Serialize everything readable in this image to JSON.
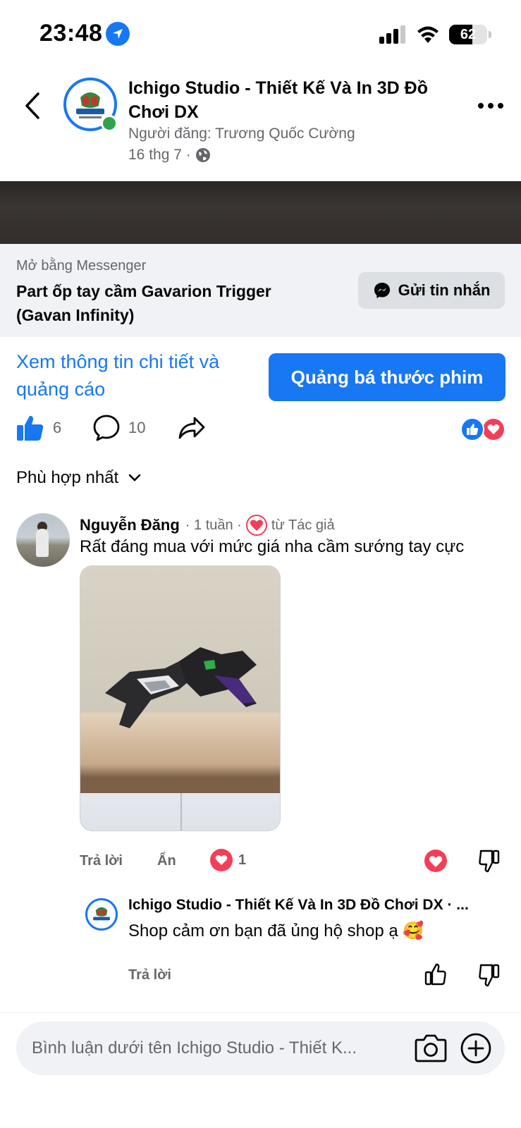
{
  "status_bar": {
    "time": "23:48",
    "battery": "62",
    "battery_level": 0.62
  },
  "post": {
    "page_name": "Ichigo Studio - Thiết Kế Và In 3D Đồ Chơi DX",
    "poster": "Người đăng: Trương Quốc Cường",
    "date": "16 thg 7 ·"
  },
  "messenger_box": {
    "small_label": "Mở bằng Messenger",
    "title": "Part ốp tay cầm Gavarion Trigger (Gavan Infinity)",
    "send_button": "Gửi tin nhắn"
  },
  "promo": {
    "link": "Xem thông tin chi tiết và quảng cáo",
    "button": "Quảng bá thước phim"
  },
  "actions": {
    "likes": "6",
    "comments": "10"
  },
  "sort": {
    "label": "Phù hợp nhất"
  },
  "comment": {
    "author": "Nguyễn Đăng",
    "time": "· 1 tuần ·",
    "author_badge": "từ Tác giả",
    "text": "Rất đáng mua với mức giá nha cầm sướng tay cực",
    "reply_label": "Trả lời",
    "hide_label": "Ẩn",
    "love_count": "1"
  },
  "reply": {
    "author": "Ichigo Studio - Thiết Kế Và In 3D Đồ Chơi DX · ...",
    "text": "Shop cảm ơn bạn đã ủng hộ shop ạ 🥰",
    "reply_label": "Trả lời"
  },
  "composer": {
    "placeholder": "Bình luận dưới tên Ichigo Studio - Thiết K..."
  },
  "colors": {
    "brand_blue": "#1877f2",
    "love_red": "#f33e58",
    "online_green": "#31a24c",
    "muted": "#65676b"
  },
  "icons": [
    "location-arrow-icon",
    "cellular-signal-icon",
    "wifi-icon",
    "battery-icon",
    "back-chevron-icon",
    "more-dots-icon",
    "globe-icon",
    "messenger-icon",
    "like-thumb-icon",
    "comment-bubble-icon",
    "share-arrow-icon",
    "heart-icon",
    "dislike-icon",
    "chevron-down-icon",
    "camera-icon",
    "plus-circle-icon"
  ]
}
